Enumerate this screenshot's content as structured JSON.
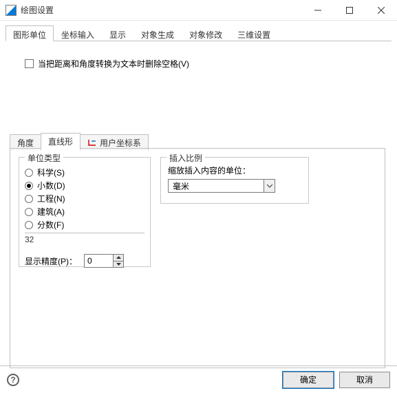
{
  "window": {
    "title": "绘图设置"
  },
  "outer_tabs": {
    "items": [
      {
        "label": "图形单位"
      },
      {
        "label": "坐标输入"
      },
      {
        "label": "显示"
      },
      {
        "label": "对象生成"
      },
      {
        "label": "对象修改"
      },
      {
        "label": "三维设置"
      }
    ],
    "active_index": 0
  },
  "checkbox": {
    "label": "当把距离和角度转换为文本时删除空格(V)",
    "checked": false
  },
  "inner_tabs": {
    "items": [
      {
        "label": "角度"
      },
      {
        "label": "直线形"
      },
      {
        "label": "用户坐标系",
        "has_icon": true
      }
    ],
    "active_index": 1
  },
  "unit_group": {
    "legend": "单位类型",
    "radios": [
      {
        "label": "科学(S)"
      },
      {
        "label": "小数(D)"
      },
      {
        "label": "工程(N)"
      },
      {
        "label": "建筑(A)"
      },
      {
        "label": "分数(F)"
      }
    ],
    "selected_index": 1,
    "readout_value": "32",
    "precision_label": "显示精度(P)：",
    "precision_value": "0"
  },
  "insert_group": {
    "legend": "插入比例",
    "label": "缩放插入内容的单位：",
    "selected": "毫米"
  },
  "buttons": {
    "ok": "确定",
    "cancel": "取消"
  }
}
